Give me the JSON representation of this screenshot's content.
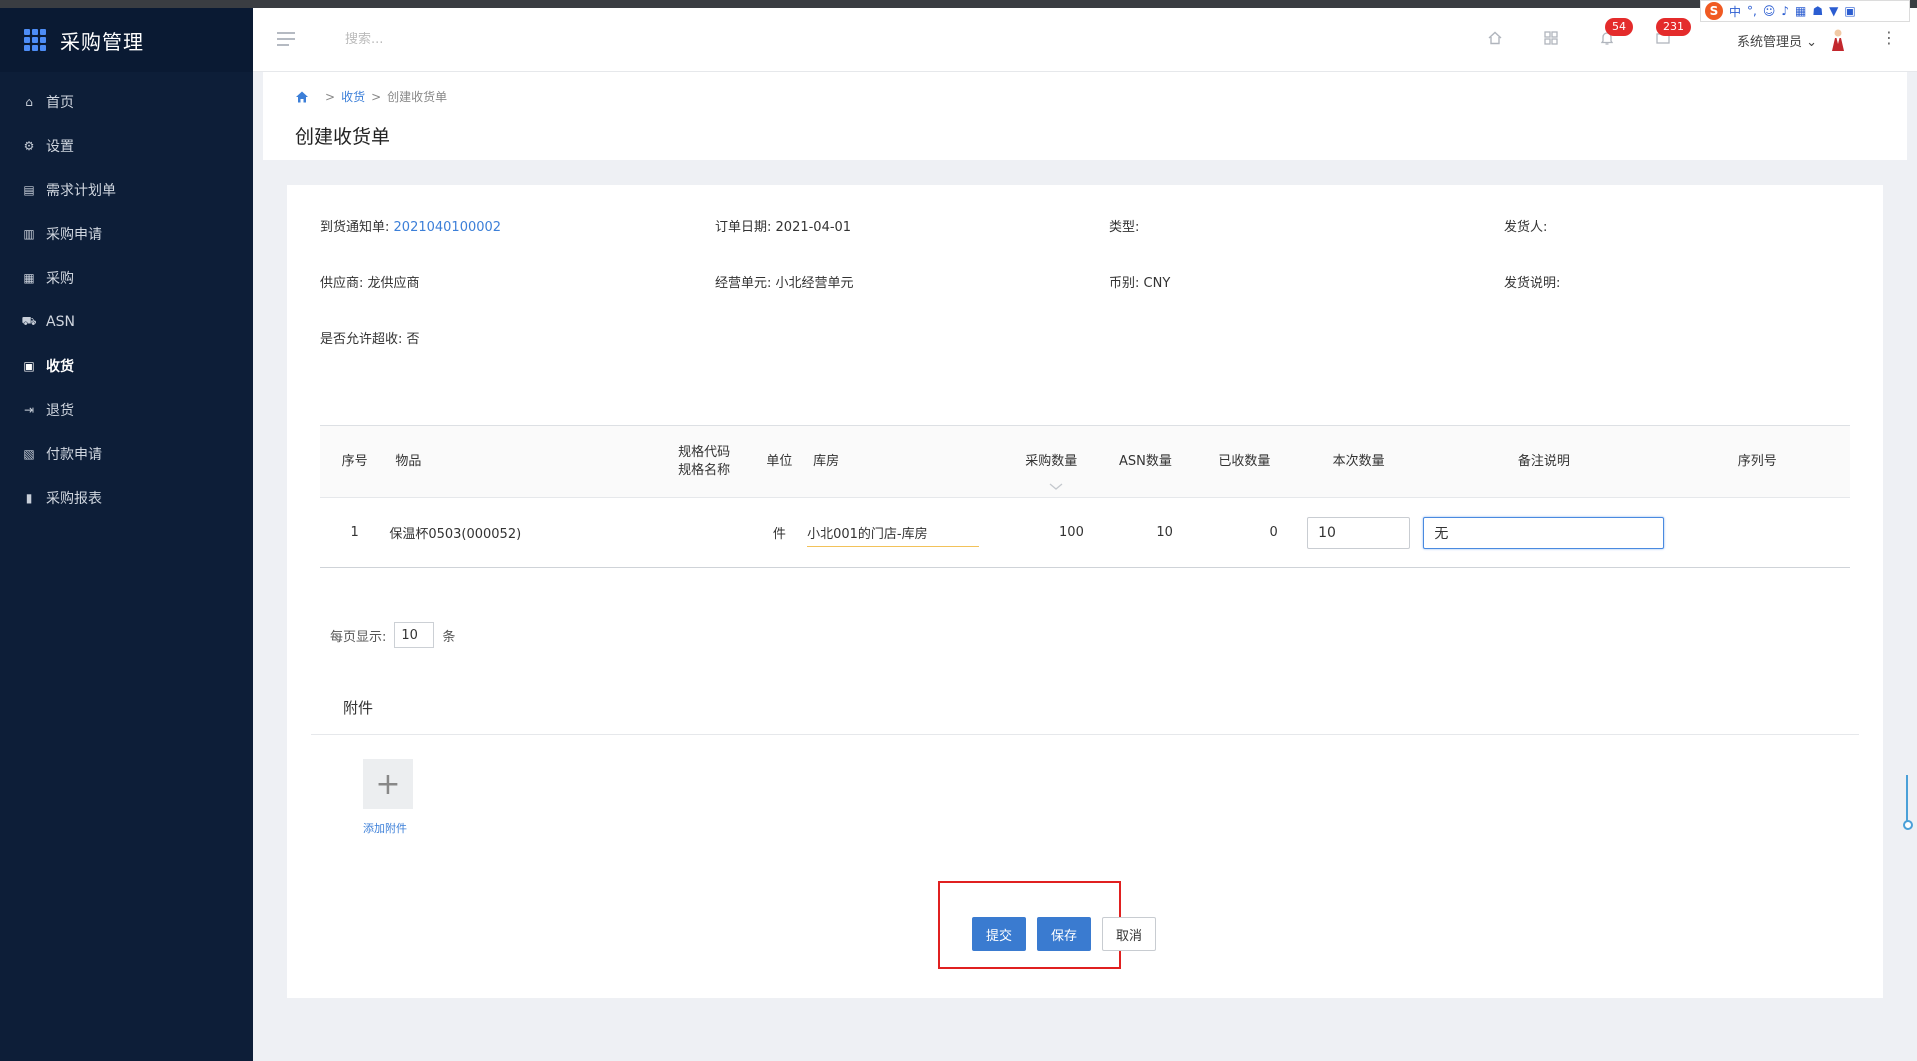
{
  "app": {
    "title": "采购管理"
  },
  "sidebar": {
    "items": [
      {
        "label": "首页",
        "icon": "home-icon",
        "glyph": "⌂"
      },
      {
        "label": "设置",
        "icon": "gear-icon",
        "glyph": "⚙"
      },
      {
        "label": "需求计划单",
        "icon": "document-icon",
        "glyph": "▤"
      },
      {
        "label": "采购申请",
        "icon": "form-icon",
        "glyph": "▥"
      },
      {
        "label": "采购",
        "icon": "list-icon",
        "glyph": "▦"
      },
      {
        "label": "ASN",
        "icon": "truck-icon",
        "glyph": "⛟"
      },
      {
        "label": "收货",
        "icon": "inbox-icon",
        "glyph": "▣"
      },
      {
        "label": "退货",
        "icon": "exit-icon",
        "glyph": "⇥"
      },
      {
        "label": "付款申请",
        "icon": "payment-icon",
        "glyph": "▧"
      },
      {
        "label": "采购报表",
        "icon": "bar-chart-icon",
        "glyph": "▮"
      }
    ],
    "active_index": 6
  },
  "header": {
    "search_placeholder": "搜索...",
    "notifications_count": "54",
    "messages_count": "231",
    "user_name": "系统管理员",
    "ime": {
      "lang": "中",
      "punct": "°,",
      "emoji": "☺",
      "mic": "♪"
    }
  },
  "breadcrumb": {
    "level1": "收货",
    "current": "创建收货单",
    "sep": ">"
  },
  "page_title": "创建收货单",
  "info": {
    "notice_label": "到货通知单:",
    "notice_value": "2021040100002",
    "order_date_label": "订单日期:",
    "order_date_value": "2021-04-01",
    "type_label": "类型:",
    "shipper_label": "发货人:",
    "supplier_label": "供应商:",
    "supplier_value": "龙供应商",
    "unit_label": "经营单元:",
    "unit_value": "小北经营单元",
    "currency_label": "币别:",
    "currency_value": "CNY",
    "ship_note_label": "发货说明:",
    "over_receive_label": "是否允许超收:",
    "over_receive_value": "否"
  },
  "table": {
    "headers": {
      "seq": "序号",
      "item": "物品",
      "spec_code": "规格代码",
      "spec_name": "规格名称",
      "unit": "单位",
      "warehouse": "库房",
      "purchase_qty": "采购数量",
      "asn_qty": "ASN数量",
      "received_qty": "已收数量",
      "this_qty": "本次数量",
      "remark": "备注说明",
      "serial": "序列号"
    },
    "rows": [
      {
        "seq": "1",
        "item": "保温杯0503(000052)",
        "unit": "件",
        "warehouse": "小北001的门店-库房",
        "purchase_qty": "100",
        "asn_qty": "10",
        "received_qty": "0",
        "this_qty": "10",
        "remark": "无"
      }
    ]
  },
  "pager": {
    "label": "每页显示:",
    "value": "10",
    "suffix": "条"
  },
  "attachments": {
    "title": "附件",
    "add_label": "添加附件"
  },
  "actions": {
    "submit": "提交",
    "save": "保存",
    "cancel": "取消"
  },
  "colors": {
    "sidebar_bg": "#0d1e38",
    "primary": "#3a7bd0",
    "link": "#3c7fd8",
    "badge": "#e42b2b",
    "highlight": "#e02020"
  }
}
